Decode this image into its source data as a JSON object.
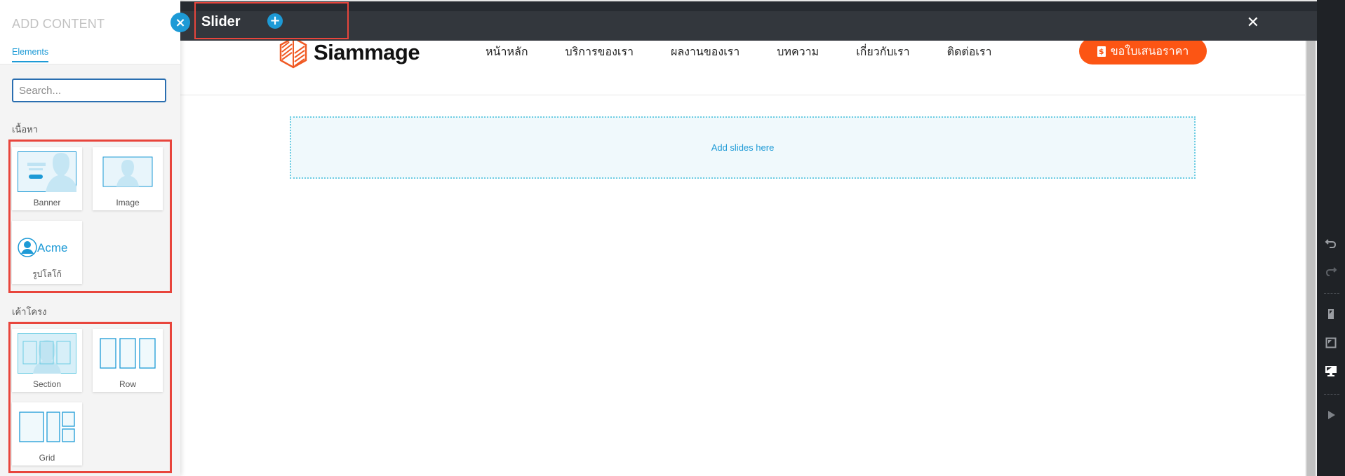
{
  "sidebar": {
    "title": "ADD CONTENT",
    "tabs": [
      {
        "label": "Elements",
        "active": true
      }
    ],
    "search": {
      "placeholder": "Search...",
      "value": ""
    },
    "groups": [
      {
        "label": "เนื้อหา",
        "items": [
          {
            "label": "Banner",
            "icon": "banner-thumbnail-icon"
          },
          {
            "label": "Image",
            "icon": "image-thumbnail-icon"
          },
          {
            "label": "รูปโลโก้",
            "icon": "logo-thumbnail-icon",
            "thumb_text": "Acme"
          }
        ]
      },
      {
        "label": "เค้าโครง",
        "items": [
          {
            "label": "Section",
            "icon": "section-thumbnail-icon"
          },
          {
            "label": "Row",
            "icon": "row-thumbnail-icon"
          },
          {
            "label": "Grid",
            "icon": "grid-thumbnail-icon"
          }
        ]
      }
    ]
  },
  "editor_header": {
    "title": "Slider",
    "add_icon": "plus-icon",
    "close_icon": "close-icon",
    "close_glyph": "✕",
    "add_glyph": "+"
  },
  "close_sidebar_glyph": "×",
  "site": {
    "logo_text": "Siammage",
    "nav": [
      "หน้าหลัก",
      "บริการของเรา",
      "ผลงานของเรา",
      "บทความ",
      "เกี่ยวกับเรา",
      "ติดต่อเรา"
    ],
    "cta": {
      "label": "ขอใบเสนอราคา",
      "icon": "dollar-document-icon",
      "icon_glyph": "$"
    },
    "brand_color": "#fc5514"
  },
  "slider": {
    "placeholder": "Add slides here"
  },
  "right_toolbar": {
    "items": [
      "undo-icon",
      "redo-icon",
      "mobile-view-icon",
      "tablet-view-icon",
      "desktop-view-icon",
      "preview-play-icon"
    ],
    "active": "desktop-view-icon"
  },
  "colors": {
    "accent": "#1d9ad6",
    "highlight": "#e8453c",
    "header_bg": "#33373d",
    "toolbar_bg": "#1f2226"
  }
}
